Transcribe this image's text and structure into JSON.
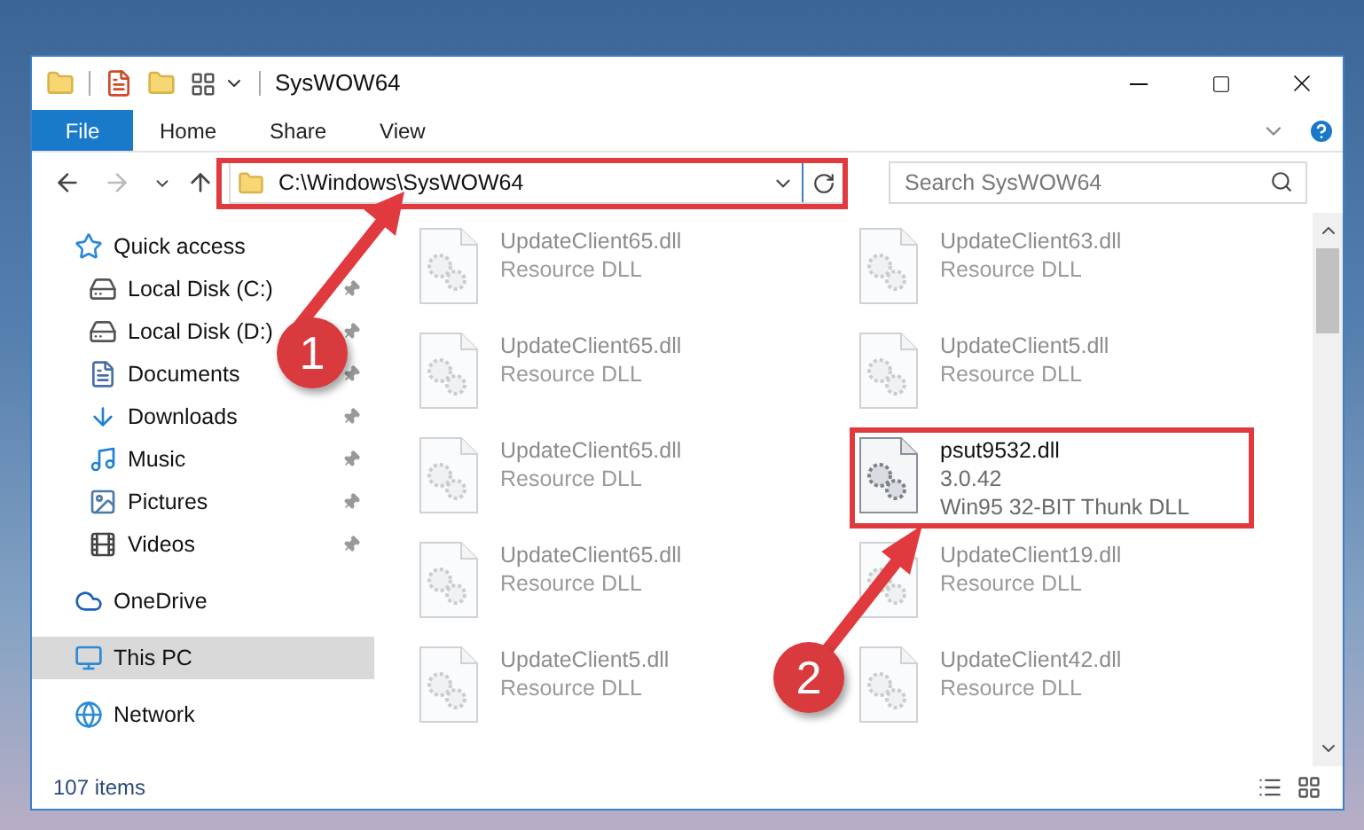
{
  "window": {
    "title": "SysWOW64"
  },
  "ribbon_tabs": [
    {
      "label": "File",
      "kind": "file"
    },
    {
      "label": "Home",
      "kind": "tab"
    },
    {
      "label": "Share",
      "kind": "tab"
    },
    {
      "label": "View",
      "kind": "tab"
    }
  ],
  "address_bar": {
    "path": "C:\\Windows\\SysWOW64"
  },
  "search": {
    "placeholder": "Search SysWOW64"
  },
  "sidebar": {
    "items": [
      {
        "label": "Quick access",
        "kind": "star",
        "pinned": false,
        "selected": false,
        "section": true
      },
      {
        "label": "Local Disk (C:)",
        "kind": "drive-c",
        "pinned": true,
        "selected": false,
        "section": false
      },
      {
        "label": "Local Disk (D:)",
        "kind": "drive",
        "pinned": true,
        "selected": false,
        "section": false
      },
      {
        "label": "Documents",
        "kind": "document",
        "pinned": true,
        "selected": false,
        "section": false
      },
      {
        "label": "Downloads",
        "kind": "download",
        "pinned": true,
        "selected": false,
        "section": false
      },
      {
        "label": "Music",
        "kind": "music",
        "pinned": true,
        "selected": false,
        "section": false
      },
      {
        "label": "Pictures",
        "kind": "picture",
        "pinned": true,
        "selected": false,
        "section": false
      },
      {
        "label": "Videos",
        "kind": "video",
        "pinned": true,
        "selected": false,
        "section": false
      },
      {
        "label": "OneDrive",
        "kind": "cloud",
        "pinned": false,
        "selected": false,
        "section": true
      },
      {
        "label": "This PC",
        "kind": "pc",
        "pinned": false,
        "selected": true,
        "section": true
      },
      {
        "label": "Network",
        "kind": "network",
        "pinned": false,
        "selected": false,
        "section": true
      }
    ]
  },
  "files": [
    {
      "name": "UpdateClient65.dll",
      "lines": [
        "Resource DLL"
      ],
      "blurred": true,
      "highlighted": false
    },
    {
      "name": "UpdateClient63.dll",
      "lines": [
        "Resource DLL"
      ],
      "blurred": true,
      "highlighted": false
    },
    {
      "name": "UpdateClient65.dll",
      "lines": [
        "Resource DLL"
      ],
      "blurred": true,
      "highlighted": false
    },
    {
      "name": "UpdateClient5.dll",
      "lines": [
        "Resource DLL"
      ],
      "blurred": true,
      "highlighted": false
    },
    {
      "name": "UpdateClient65.dll",
      "lines": [
        "Resource DLL"
      ],
      "blurred": true,
      "highlighted": false
    },
    {
      "name": "psut9532.dll",
      "lines": [
        "3.0.42",
        "Win95 32-BIT Thunk DLL"
      ],
      "blurred": false,
      "highlighted": true
    },
    {
      "name": "UpdateClient65.dll",
      "lines": [
        "Resource DLL"
      ],
      "blurred": true,
      "highlighted": false
    },
    {
      "name": "UpdateClient19.dll",
      "lines": [
        "Resource DLL"
      ],
      "blurred": true,
      "highlighted": false
    },
    {
      "name": "UpdateClient5.dll",
      "lines": [
        "Resource DLL"
      ],
      "blurred": true,
      "highlighted": false
    },
    {
      "name": "UpdateClient42.dll",
      "lines": [
        "Resource DLL"
      ],
      "blurred": true,
      "highlighted": false
    }
  ],
  "status_bar": {
    "count": "107 items"
  },
  "annotations": [
    {
      "number": "1"
    },
    {
      "number": "2"
    }
  ]
}
